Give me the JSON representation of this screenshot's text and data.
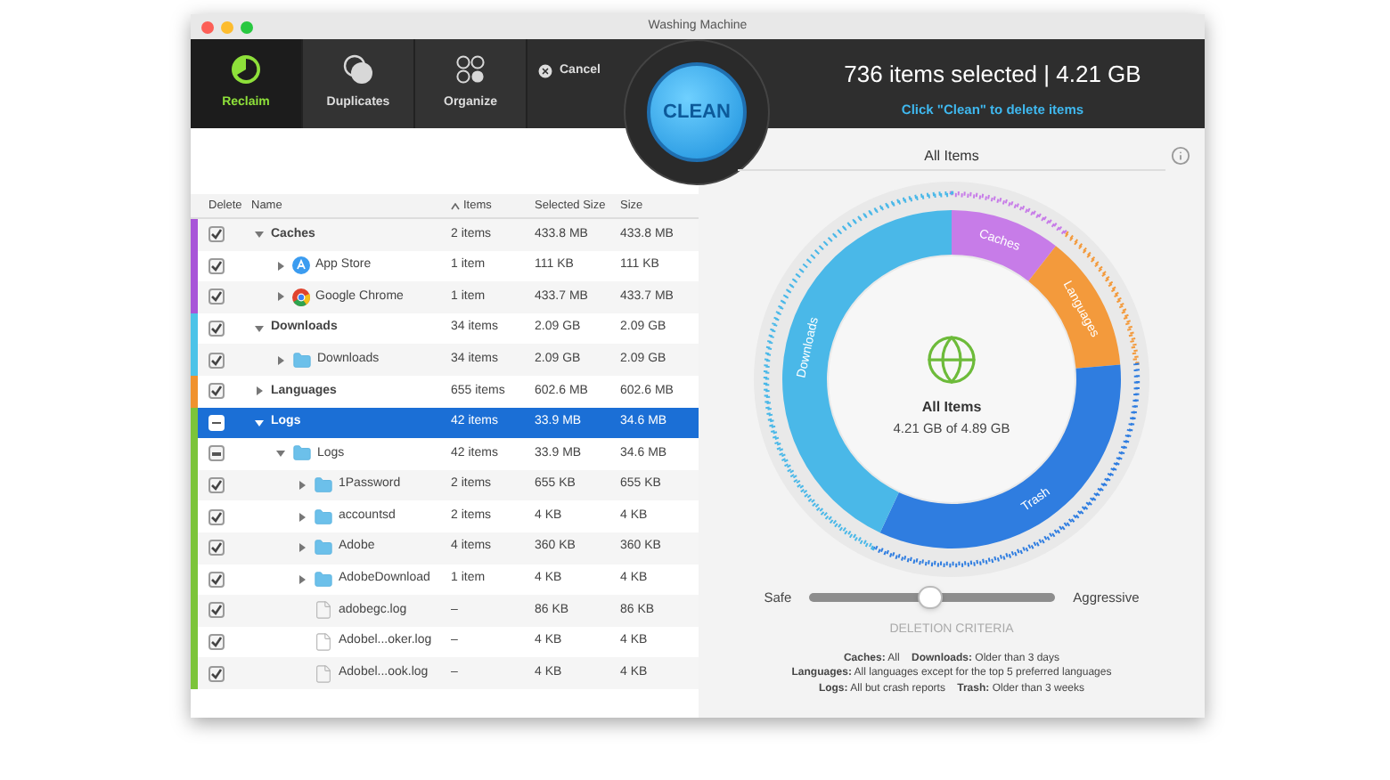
{
  "window": {
    "title": "Washing Machine"
  },
  "toolbar": {
    "tabs": [
      {
        "label": "Reclaim",
        "selected": true
      },
      {
        "label": "Duplicates",
        "selected": false
      },
      {
        "label": "Organize",
        "selected": false
      }
    ],
    "cancel": "Cancel",
    "clean": "CLEAN",
    "summary": "736 items selected | 4.21 GB",
    "hint": "Click \"Clean\" to delete items"
  },
  "table": {
    "columns": [
      {
        "label": "Delete",
        "sorted": false
      },
      {
        "label": "Name",
        "sorted": false
      },
      {
        "label": "Items",
        "sorted": true
      },
      {
        "label": "Selected Size",
        "sorted": false
      },
      {
        "label": "Size",
        "sorted": false
      }
    ],
    "rows": [
      {
        "name": "Caches",
        "items": "2 items",
        "selected_size": "433.8 MB",
        "size": "433.8 MB",
        "kind": "category",
        "color": "#a855d8",
        "checked": true,
        "partial": false,
        "expanded": true,
        "selected": false,
        "children": [
          {
            "name": "App Store",
            "items": "1 item",
            "selected_size": "111 KB",
            "size": "111 KB",
            "kind": "store_app",
            "checked": true,
            "partial": false,
            "expanded": false,
            "selected": false
          },
          {
            "name": "Google Chrome",
            "items": "1 item",
            "selected_size": "433.7 MB",
            "size": "433.7 MB",
            "kind": "browser_app",
            "checked": true,
            "partial": false,
            "expanded": false,
            "selected": false
          }
        ]
      },
      {
        "name": "Downloads",
        "items": "34 items",
        "selected_size": "2.09 GB",
        "size": "2.09 GB",
        "kind": "category",
        "color": "#4cc3e8",
        "checked": true,
        "partial": false,
        "expanded": true,
        "selected": false,
        "children": [
          {
            "name": "Downloads",
            "items": "34 items",
            "selected_size": "2.09 GB",
            "size": "2.09 GB",
            "kind": "folder",
            "checked": true,
            "partial": false,
            "expanded": false,
            "selected": false
          }
        ]
      },
      {
        "name": "Languages",
        "items": "655 items",
        "selected_size": "602.6 MB",
        "size": "602.6 MB",
        "kind": "category",
        "color": "#f0922e",
        "checked": true,
        "partial": false,
        "expanded": false,
        "selected": false
      },
      {
        "name": "Logs",
        "items": "42 items",
        "selected_size": "33.9 MB",
        "size": "34.6 MB",
        "kind": "category",
        "color": "#7cc43a",
        "partial": true,
        "expanded": true,
        "selected": true,
        "children": [
          {
            "name": "Logs",
            "items": "42 items",
            "selected_size": "33.9 MB",
            "size": "34.6 MB",
            "kind": "folder",
            "partial": true,
            "expanded": true,
            "selected": false,
            "children": [
              {
                "name": "1Password",
                "items": "2 items",
                "selected_size": "655 KB",
                "size": "655 KB",
                "kind": "folder",
                "checked": true,
                "partial": false,
                "expanded": false,
                "selected": false
              },
              {
                "name": "accountsd",
                "items": "2 items",
                "selected_size": "4 KB",
                "size": "4 KB",
                "kind": "folder",
                "checked": true,
                "partial": false,
                "expanded": false,
                "selected": false
              },
              {
                "name": "Adobe",
                "items": "4 items",
                "selected_size": "360 KB",
                "size": "360 KB",
                "kind": "folder",
                "checked": true,
                "partial": false,
                "expanded": false,
                "selected": false
              },
              {
                "name": "AdobeDownload",
                "items": "1 item",
                "selected_size": "4 KB",
                "size": "4 KB",
                "kind": "folder",
                "checked": true,
                "partial": false,
                "expanded": false,
                "selected": false
              },
              {
                "name": "adobegc.log",
                "items": "–",
                "selected_size": "86 KB",
                "size": "86 KB",
                "kind": "file",
                "checked": true,
                "partial": false,
                "selected": false
              },
              {
                "name": "Adobel...oker.log",
                "items": "–",
                "selected_size": "4 KB",
                "size": "4 KB",
                "kind": "file",
                "checked": true,
                "partial": false,
                "selected": false
              },
              {
                "name": "Adobel...ook.log",
                "items": "–",
                "selected_size": "4 KB",
                "size": "4 KB",
                "kind": "file",
                "checked": true,
                "partial": false,
                "selected": false
              }
            ]
          }
        ]
      }
    ]
  },
  "chart": {
    "title": "All Items",
    "segments": [
      {
        "label": "Caches",
        "color": "#c77ce8"
      },
      {
        "label": "Languages",
        "color": "#f39a3c"
      },
      {
        "label": "Trash",
        "color": "#2f7de0"
      },
      {
        "label": "Downloads",
        "color": "#4ab8e8"
      }
    ],
    "center_title": "All Items",
    "center_value": "4.21 GB of 4.89 GB"
  },
  "criteria": {
    "min_label": "Safe",
    "max_label": "Aggressive",
    "level": 0.49,
    "title": "DELETION CRITERIA",
    "lines": [
      "**Caches:** All    **Downloads:** Older than 3 days",
      "**Languages:** All languages except for the top 5 preferred languages",
      "**Logs:** All but crash reports    **Trash:** Older than 3 weeks"
    ]
  }
}
